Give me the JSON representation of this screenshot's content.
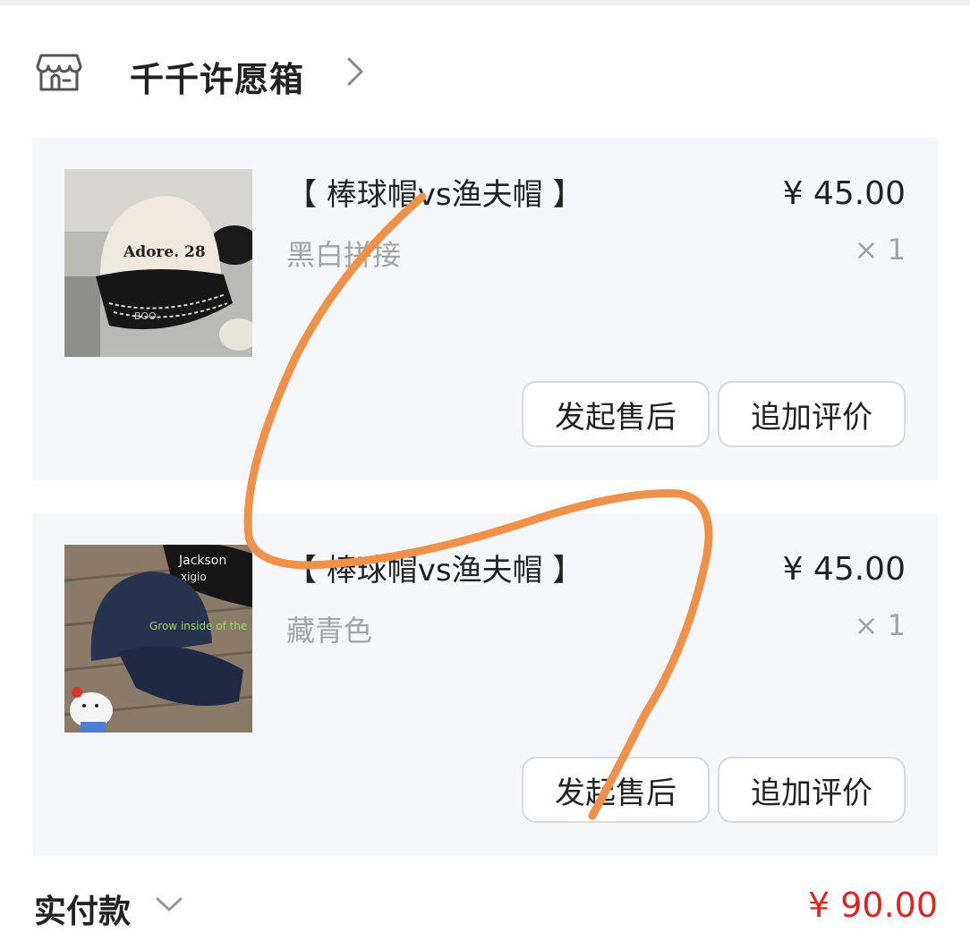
{
  "shop": {
    "name": "千千许愿箱",
    "icon": "store-icon",
    "chevron_icon": "chevron-right-icon"
  },
  "items": [
    {
      "title": "【 棒球帽vs渔夫帽 】",
      "variant": "黑白拼接",
      "price": "¥ 45.00",
      "quantity": "× 1",
      "image": "cream-black-baseball-cap-photo",
      "image_text": "Adore. 28",
      "buttons": {
        "after_sale": "发起售后",
        "review": "追加评价"
      }
    },
    {
      "title": "【 棒球帽vs渔夫帽 】",
      "variant": "藏青色",
      "price": "¥ 45.00",
      "quantity": "× 1",
      "image": "navy-baseball-cap-photo",
      "image_text": "Grow inside of the",
      "buttons": {
        "after_sale": "发起售后",
        "review": "追加评价"
      }
    }
  ],
  "footer": {
    "paid_label": "实付款",
    "paid_amount": "¥ 90.00",
    "chevron_icon": "chevron-down-icon"
  },
  "colors": {
    "card_bg": "#f6f7fb",
    "price_red": "#e02424",
    "muted_text": "#a3a3a3",
    "scribble": "#f0914a"
  }
}
